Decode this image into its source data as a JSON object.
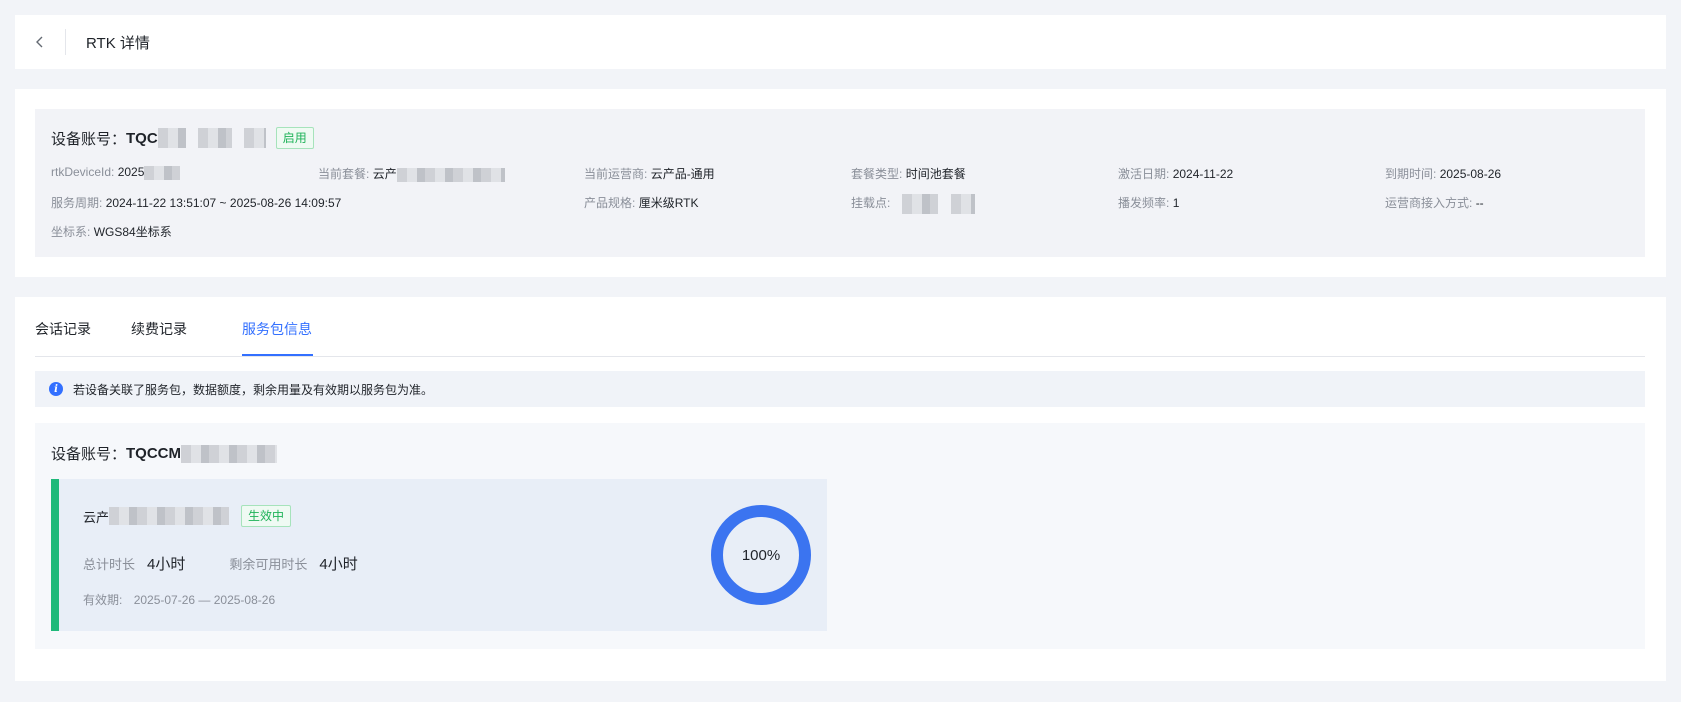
{
  "header": {
    "title": "RTK 详情"
  },
  "device": {
    "account_label": "设备账号：",
    "account_value": "TQC",
    "status": "启用",
    "fields": {
      "rtk_device_id": {
        "k": "rtkDeviceId:",
        "v": "2025"
      },
      "current_package": {
        "k": "当前套餐:",
        "v": "云产"
      },
      "operator": {
        "k": "当前运营商:",
        "v": "云产品-通用"
      },
      "package_type": {
        "k": "套餐类型:",
        "v": "时间池套餐"
      },
      "activation_date": {
        "k": "激活日期:",
        "v": "2024-11-22"
      },
      "expire_time": {
        "k": "到期时间:",
        "v": "2025-08-26"
      },
      "service_period": {
        "k": "服务周期:",
        "v": "2024-11-22 13:51:07 ~ 2025-08-26 14:09:57"
      },
      "product_spec": {
        "k": "产品规格:",
        "v": "厘米级RTK"
      },
      "mount_point": {
        "k": "挂载点:",
        "v": ""
      },
      "broadcast_freq": {
        "k": "播发频率:",
        "v": "1"
      },
      "operator_access": {
        "k": "运营商接入方式:",
        "v": "--"
      },
      "coord_system": {
        "k": "坐标系:",
        "v": "WGS84坐标系"
      }
    }
  },
  "tabs": [
    {
      "label": "会话记录",
      "active": false
    },
    {
      "label": "续费记录",
      "active": false
    },
    {
      "label": "服务包信息",
      "active": true
    }
  ],
  "notice": {
    "icon": "info-icon",
    "text": "若设备关联了服务包，数据额度，剩余用量及有效期以服务包为准。"
  },
  "package_panel": {
    "account_label": "设备账号：",
    "account_value": "TQCCM",
    "card": {
      "name": "云产",
      "status": "生效中",
      "total_label": "总计时长",
      "total_value": "4小时",
      "remaining_label": "剩余可用时长",
      "remaining_value": "4小时",
      "validity_label": "有效期:",
      "validity_value": "2025-07-26 — 2025-08-26",
      "progress_percent": 100,
      "progress_label": "100%"
    }
  },
  "colors": {
    "accent": "#3370ff",
    "success": "#1fb97a"
  }
}
